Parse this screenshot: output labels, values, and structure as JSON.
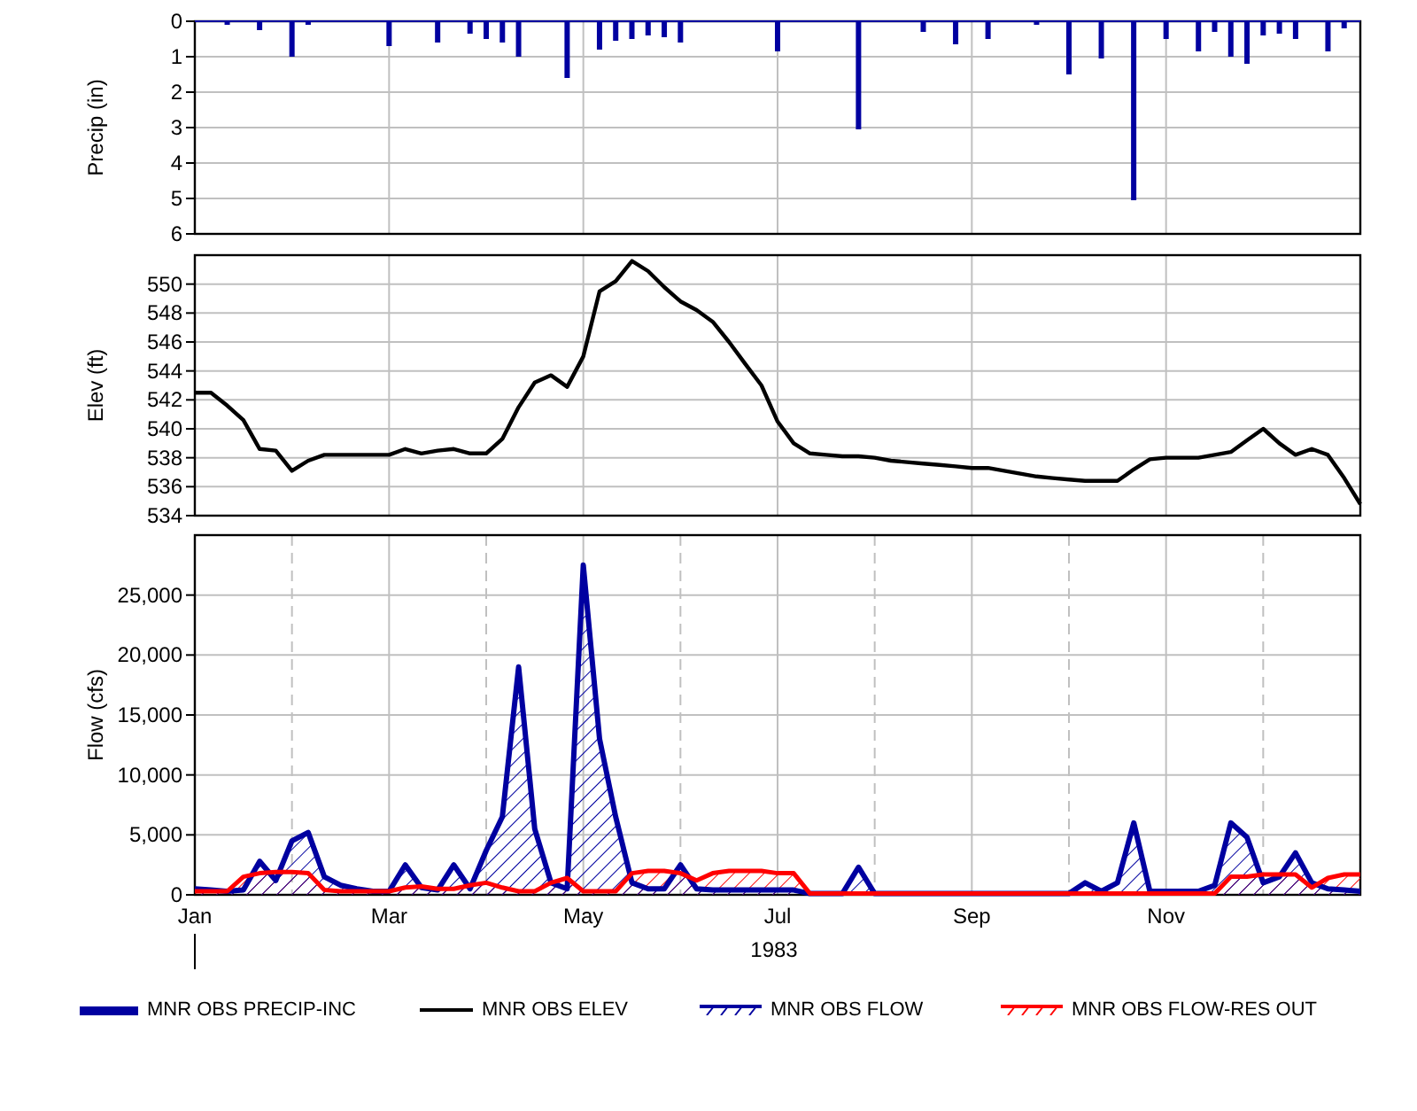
{
  "charts": [
    {
      "chart_data": {
        "type": "bar",
        "grid": true,
        "ylabel": "Precip (in)",
        "ylim": [
          6,
          0
        ],
        "yticks": [
          {
            "value": 0,
            "label": "0"
          },
          {
            "value": 1,
            "label": "1"
          },
          {
            "value": 2,
            "label": "2"
          },
          {
            "value": 3,
            "label": "3"
          },
          {
            "value": 4,
            "label": "4"
          },
          {
            "value": 5,
            "label": "5"
          },
          {
            "value": 6,
            "label": "6"
          }
        ],
        "categories": [
          null,
          null,
          null,
          null,
          null,
          null,
          null,
          null,
          null,
          null,
          null,
          null,
          null,
          null,
          null,
          null,
          null,
          null,
          null,
          null,
          null,
          null,
          null,
          null,
          null,
          null,
          null,
          null,
          null,
          null,
          null,
          null,
          null,
          null,
          null,
          null,
          null,
          null,
          null,
          null,
          null,
          null,
          null,
          null,
          null,
          null,
          null,
          null,
          null,
          null,
          null,
          null,
          null,
          null,
          null,
          null,
          null,
          null,
          null,
          null,
          null,
          null,
          null,
          null,
          null,
          null,
          null,
          null,
          null,
          null,
          null,
          null,
          null
        ],
        "series": [
          {
            "name": "MNR OBS PRECIP-INC",
            "color": "#0000a0",
            "values": [
              0,
              0,
              0.1,
              0,
              0.25,
              0,
              1.0,
              0.1,
              0,
              0,
              0,
              0,
              0.7,
              0,
              0,
              0.6,
              0,
              0.35,
              0.5,
              0.6,
              1.0,
              0,
              0,
              1.6,
              0,
              0.8,
              0.55,
              0.5,
              0.4,
              0.45,
              0.6,
              0,
              0,
              0,
              0,
              0,
              0.85,
              0,
              0,
              0,
              0,
              3.05,
              0,
              0,
              0,
              0.3,
              0,
              0.65,
              0,
              0.5,
              0,
              0,
              0.1,
              0,
              1.5,
              0,
              1.05,
              0,
              5.05,
              0,
              0.5,
              0,
              0.85,
              0.3,
              1.0,
              1.2,
              0.4,
              0.35,
              0.5,
              0,
              0.85,
              0.2,
              0
            ]
          }
        ]
      }
    },
    {
      "chart_data": {
        "type": "line",
        "grid": true,
        "ylabel": "Elev (ft)",
        "ylim": [
          534,
          552
        ],
        "yticks": [
          {
            "value": 534,
            "label": "534"
          },
          {
            "value": 536,
            "label": "536"
          },
          {
            "value": 538,
            "label": "538"
          },
          {
            "value": 540,
            "label": "540"
          },
          {
            "value": 542,
            "label": "542"
          },
          {
            "value": 544,
            "label": "544"
          },
          {
            "value": 546,
            "label": "546"
          },
          {
            "value": 548,
            "label": "548"
          },
          {
            "value": 550,
            "label": "550"
          }
        ],
        "categories": [
          null,
          null,
          null,
          null,
          null,
          null,
          null,
          null,
          null,
          null,
          null,
          null,
          null,
          null,
          null,
          null,
          null,
          null,
          null,
          null,
          null,
          null,
          null,
          null,
          null,
          null,
          null,
          null,
          null,
          null,
          null,
          null,
          null,
          null,
          null,
          null,
          null,
          null,
          null,
          null,
          null,
          null,
          null,
          null,
          null,
          null,
          null,
          null,
          null,
          null,
          null,
          null,
          null,
          null,
          null,
          null,
          null,
          null,
          null,
          null,
          null,
          null,
          null,
          null,
          null,
          null,
          null,
          null,
          null,
          null,
          null,
          null,
          null
        ],
        "series": [
          {
            "name": "MNR OBS ELEV",
            "color": "#000000",
            "values": [
              542.5,
              542.5,
              541.6,
              540.6,
              538.6,
              538.5,
              537.1,
              537.8,
              538.2,
              538.2,
              538.2,
              538.2,
              538.2,
              538.6,
              538.3,
              538.5,
              538.6,
              538.3,
              538.3,
              539.3,
              541.5,
              543.2,
              543.7,
              542.9,
              545,
              549.5,
              550.2,
              551.6,
              550.9,
              549.8,
              548.8,
              548.2,
              547.4,
              546,
              544.5,
              543,
              540.5,
              539,
              538.3,
              538.2,
              538.1,
              538.1,
              538,
              537.8,
              537.7,
              537.6,
              537.5,
              537.4,
              537.3,
              537.3,
              537.1,
              536.9,
              536.7,
              536.6,
              536.5,
              536.4,
              536.4,
              536.4,
              537.2,
              537.9,
              538,
              538,
              538,
              538.2,
              538.4,
              539.2,
              540,
              539,
              538.2,
              538.6,
              538.2,
              536.6,
              534.8
            ]
          }
        ]
      }
    },
    {
      "chart_data": {
        "type": "area",
        "grid": true,
        "ylabel": "Flow (cfs)",
        "xlabel": "1983",
        "ylim": [
          0,
          30000
        ],
        "yticks": [
          {
            "value": 0,
            "label": "0"
          },
          {
            "value": 5000,
            "label": "5,000"
          },
          {
            "value": 10000,
            "label": "10,000"
          },
          {
            "value": 15000,
            "label": "15,000"
          },
          {
            "value": 20000,
            "label": "20,000"
          },
          {
            "value": 25000,
            "label": "25,000"
          }
        ],
        "categories": [
          "Jan",
          null,
          null,
          null,
          null,
          null,
          null,
          null,
          null,
          null,
          null,
          null,
          "Mar",
          null,
          null,
          null,
          null,
          null,
          null,
          null,
          null,
          null,
          null,
          null,
          "May",
          null,
          null,
          null,
          null,
          null,
          null,
          null,
          null,
          null,
          null,
          null,
          "Jul",
          null,
          null,
          null,
          null,
          null,
          null,
          null,
          null,
          null,
          null,
          null,
          "Sep",
          null,
          null,
          null,
          null,
          null,
          null,
          null,
          null,
          null,
          null,
          null,
          "Nov",
          null,
          null,
          null,
          null,
          null,
          null,
          null,
          null,
          null,
          null,
          null,
          null
        ],
        "series": [
          {
            "name": "MNR OBS FLOW",
            "color": "#0000a0",
            "values": [
              500,
              400,
              300,
              400,
              2800,
              1200,
              4500,
              5200,
              1500,
              800,
              500,
              300,
              300,
              2500,
              600,
              400,
              2500,
              500,
              3700,
              6500,
              19000,
              5500,
              1000,
              500,
              27500,
              13000,
              6500,
              1000,
              500,
              500,
              2500,
              500,
              400,
              400,
              400,
              400,
              400,
              400,
              100,
              100,
              100,
              2300,
              100,
              100,
              100,
              100,
              100,
              100,
              100,
              100,
              100,
              100,
              100,
              100,
              100,
              1000,
              300,
              1000,
              6000,
              300,
              300,
              300,
              300,
              800,
              6000,
              4800,
              1000,
              1500,
              3500,
              1000,
              500,
              400,
              300
            ]
          },
          {
            "name": "MNR OBS FLOW-RES OUT",
            "color": "#ff0000",
            "values": [
              300,
              300,
              300,
              1500,
              1800,
              1900,
              1900,
              1800,
              400,
              300,
              300,
              300,
              300,
              600,
              700,
              500,
              500,
              800,
              1000,
              600,
              300,
              300,
              1000,
              1400,
              300,
              300,
              300,
              1800,
              2000,
              2000,
              1800,
              1200,
              1800,
              2000,
              2000,
              2000,
              1800,
              1800,
              100,
              100,
              100,
              100,
              100,
              100,
              100,
              100,
              100,
              100,
              100,
              100,
              100,
              100,
              100,
              100,
              100,
              100,
              100,
              100,
              100,
              100,
              100,
              100,
              100,
              100,
              1500,
              1500,
              1700,
              1700,
              1700,
              600,
              1400,
              1700,
              1700
            ]
          }
        ]
      }
    }
  ]
}
